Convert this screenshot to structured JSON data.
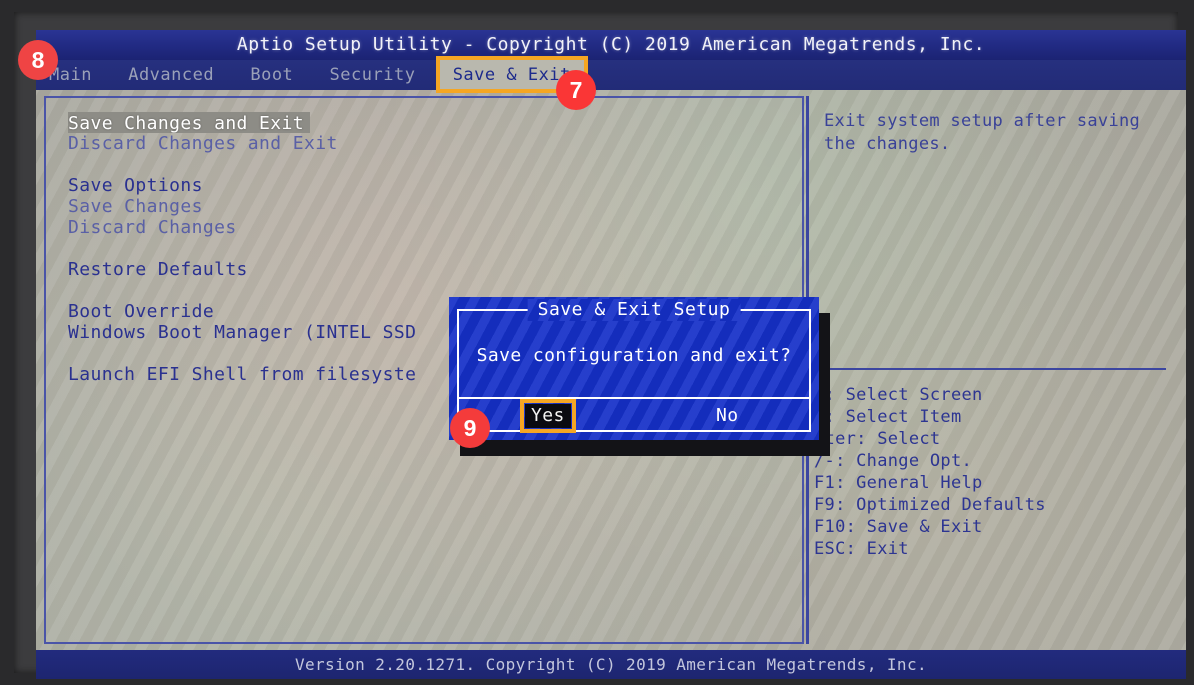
{
  "titlebar": {
    "text": "Aptio Setup Utility - Copyright (C) 2019 American Megatrends, Inc."
  },
  "menubar": {
    "tabs": [
      {
        "label": "Main",
        "active": false
      },
      {
        "label": "Advanced",
        "active": false
      },
      {
        "label": "Boot",
        "active": false
      },
      {
        "label": "Security",
        "active": false
      },
      {
        "label": "Save & Exit",
        "active": true
      }
    ]
  },
  "menu_items": [
    {
      "label": "Save Changes and Exit",
      "state": "selected"
    },
    {
      "label": "Discard Changes and Exit",
      "state": "dim"
    },
    {
      "label": "",
      "state": "gap"
    },
    {
      "label": "Save Options",
      "state": "normal"
    },
    {
      "label": "Save Changes",
      "state": "dim"
    },
    {
      "label": "Discard Changes",
      "state": "dim"
    },
    {
      "label": "",
      "state": "gap"
    },
    {
      "label": "Restore Defaults",
      "state": "normal"
    },
    {
      "label": "",
      "state": "gap"
    },
    {
      "label": "Boot Override",
      "state": "normal"
    },
    {
      "label": "Windows Boot Manager (INTEL SSD",
      "state": "normal"
    },
    {
      "label": "",
      "state": "gap"
    },
    {
      "label": "Launch EFI Shell from filesyste",
      "state": "normal"
    }
  ],
  "help": {
    "text": "Exit system setup after saving the changes."
  },
  "key_legend": [
    "↔: Select Screen",
    "↓: Select Item",
    "nter: Select",
    "/-: Change Opt.",
    "F1: General Help",
    "F9: Optimized Defaults",
    "F10: Save & Exit",
    "ESC: Exit"
  ],
  "footer": {
    "text": "Version 2.20.1271. Copyright (C) 2019 American Megatrends, Inc."
  },
  "dialog": {
    "title": "Save & Exit Setup",
    "message": "Save configuration and exit?",
    "yes_label": "Yes",
    "no_label": "No",
    "selected_button": "Yes"
  },
  "badges": [
    {
      "number": "7"
    },
    {
      "number": "8"
    },
    {
      "number": "9"
    }
  ],
  "colors": {
    "accent_highlight": "#f5a623",
    "badge_red": "#f03b3b",
    "dialog_blue": "#1530c8",
    "titlebar_blue": "#232c80",
    "menu_text_blue": "#2a3190"
  }
}
